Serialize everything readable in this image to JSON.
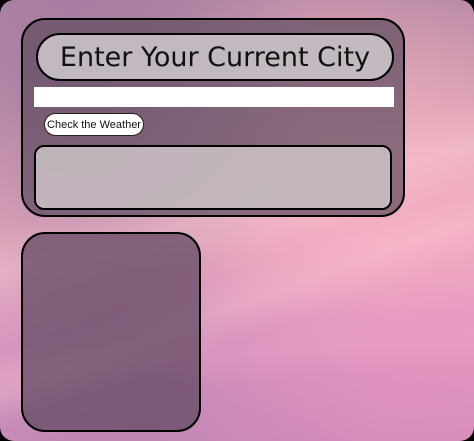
{
  "header": {
    "title": "Enter Your Current City"
  },
  "search": {
    "value": "",
    "placeholder": ""
  },
  "actions": {
    "check_weather_label": "Check the Weather"
  },
  "result": {
    "text": ""
  },
  "forecast": {
    "text": ""
  },
  "colors": {
    "panel": "#5f4b5f",
    "title_pill": "#c8c0c8",
    "result_box": "#cdc3c8",
    "border": "#000000",
    "sky_pink": "#f3b3c0",
    "sky_purple": "#b98aa6"
  }
}
